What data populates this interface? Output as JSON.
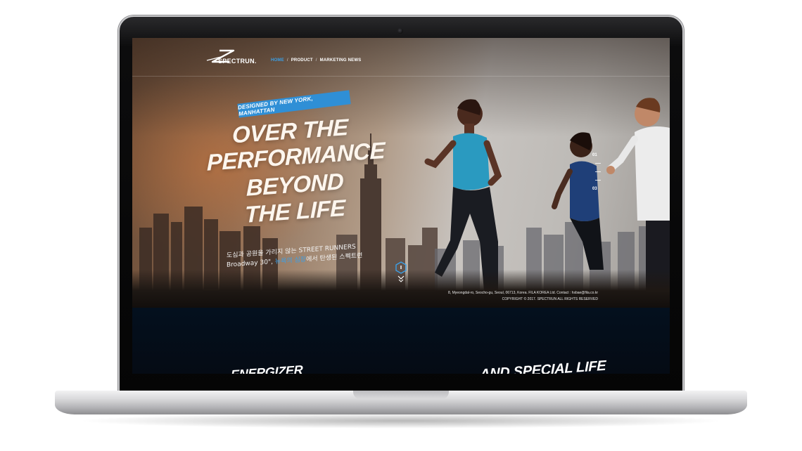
{
  "header": {
    "logo_text": "SPECTRUN.",
    "nav": [
      {
        "label": "HOME"
      },
      {
        "label": "PRODUCT"
      },
      {
        "label": "MARKETING NEWS"
      }
    ],
    "separator": "/"
  },
  "hero": {
    "badge": "DESIGNED BY NEW YORK, MANHATTAN",
    "headline": [
      "OVER THE",
      "PERFORMANCE",
      "BEYOND",
      "THE LIFE"
    ],
    "subtext_line1": "도심과 공원을 가리지 않는 STREET RUNNERS",
    "subtext_line2_a": "Broadway 30\", ",
    "subtext_line2_highlight": "뉴욕의 심장",
    "subtext_line2_b": "에서 탄생된 스펙트런",
    "pager": {
      "first": "01",
      "last": "03"
    }
  },
  "footer": {
    "address": "8, Myeongdal-ro, Seocho-gu, Seoul, 06713, Korea. FILA KOREA Ltd.   Contact : hsbae@fila.co.kr",
    "copyright": "COPYRIGHT © 2017. SPECTRUN ALL RIGHTS RESERVED"
  },
  "lower": {
    "left_text": "ENERGIZER",
    "right_text": "AND SPECIAL LIFE"
  },
  "colors": {
    "accent": "#3aa0e8",
    "badge_bg": "#2f8fd6",
    "lower_bg": "#04101e"
  }
}
